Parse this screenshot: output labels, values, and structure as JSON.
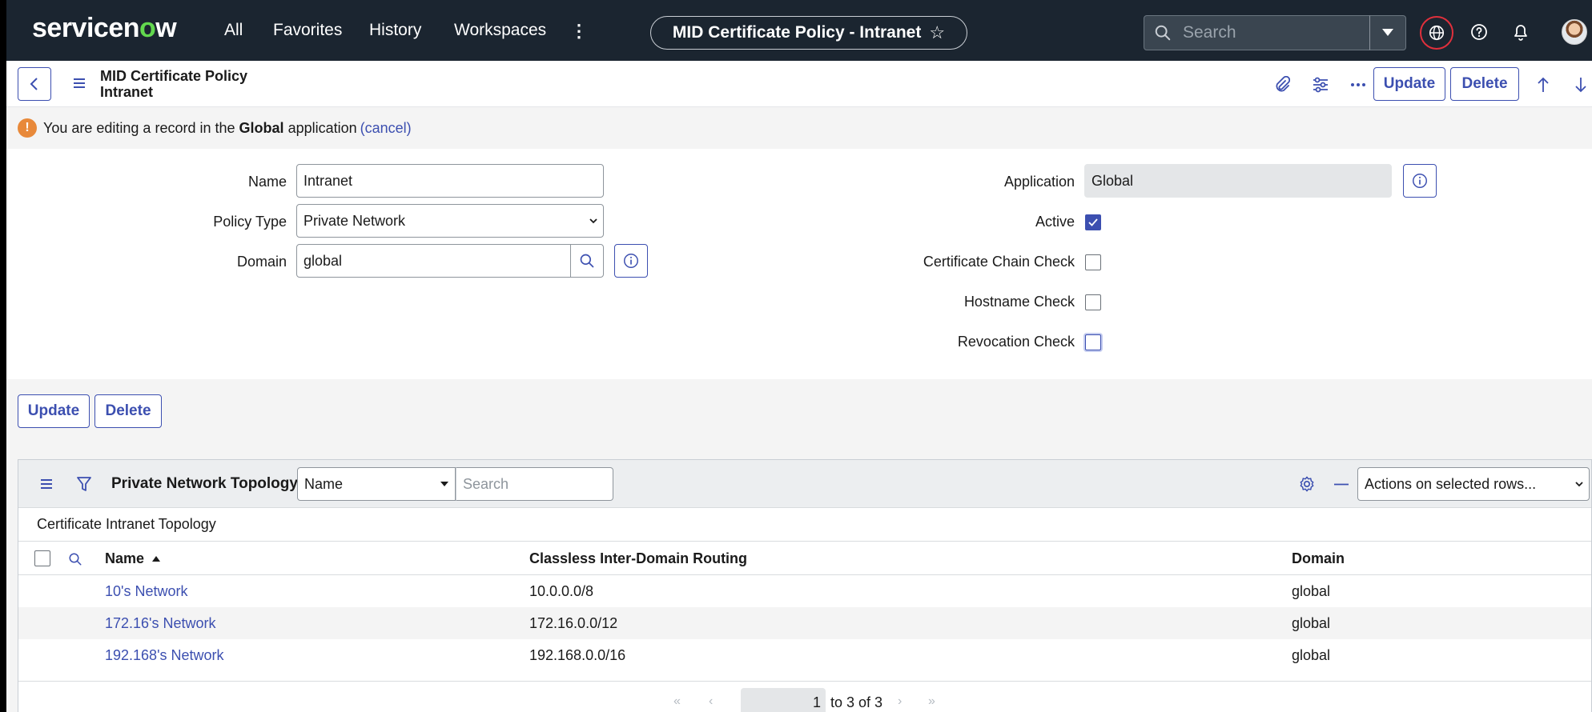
{
  "nav": {
    "brand_a": "servicen",
    "brand_o": "o",
    "brand_b": "w",
    "all": "All",
    "favorites": "Favorites",
    "history": "History",
    "workspaces": "Workspaces",
    "more": "⋮",
    "context_title": "MID Certificate Policy - Intranet",
    "search_placeholder": "Search"
  },
  "header": {
    "record_type": "MID Certificate Policy",
    "record_name": "Intranet",
    "update_label": "Update",
    "delete_label": "Delete"
  },
  "alert": {
    "prefix": "You are editing a record in the",
    "app": "Global",
    "suffix": "application",
    "cancel": "(cancel)"
  },
  "form": {
    "name_label": "Name",
    "name_value": "Intranet",
    "policy_type_label": "Policy Type",
    "policy_type_value": "Private Network",
    "domain_label": "Domain",
    "domain_value": "global",
    "application_label": "Application",
    "application_value": "Global",
    "active_label": "Active",
    "active_checked": true,
    "chain_label": "Certificate Chain Check",
    "chain_checked": false,
    "hostname_label": "Hostname Check",
    "hostname_checked": false,
    "revocation_label": "Revocation Check",
    "revocation_checked": false
  },
  "bottom_buttons": {
    "update": "Update",
    "delete": "Delete"
  },
  "related_list": {
    "title": "Private Network Topology",
    "field_select": "Name",
    "search_placeholder": "Search",
    "actions": "Actions on selected rows...",
    "subtitle": "Certificate Intranet Topology",
    "columns": [
      "Name",
      "Classless Inter-Domain Routing",
      "Domain"
    ],
    "rows": [
      {
        "name": "10's Network",
        "cidr": "10.0.0.0/8",
        "domain": "global"
      },
      {
        "name": "172.16's Network",
        "cidr": "172.16.0.0/12",
        "domain": "global"
      },
      {
        "name": "192.168's Network",
        "cidr": "192.168.0.0/16",
        "domain": "global"
      }
    ],
    "pager_page": "1",
    "pager_text": "to 3 of 3"
  },
  "colors": {
    "nav_bg": "#1b2530",
    "accent": "#3c4fb0",
    "brand_green": "#62d84e",
    "warning": "#e8893a",
    "globe_ring": "#e0303c"
  }
}
